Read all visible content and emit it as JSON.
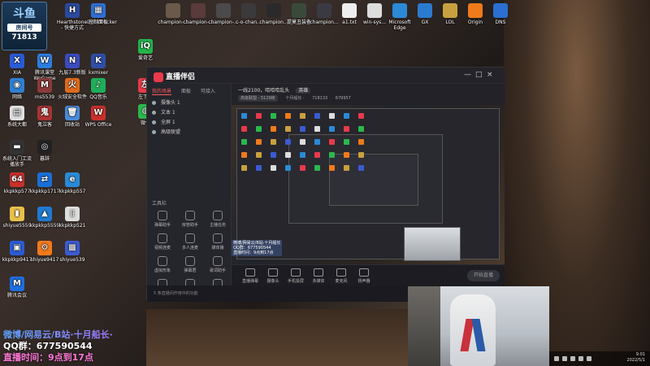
{
  "room_badge": {
    "logo": "斗鱼",
    "label": "房间号",
    "number": "71813"
  },
  "desktop_icons": [
    {
      "label": "XIA",
      "glyph": "X",
      "color": "#2a5bd7"
    },
    {
      "label": "腾讯课堂 WeGame",
      "glyph": "W",
      "color": "#2d7de0"
    },
    {
      "label": "九层7.3新版",
      "glyph": "N",
      "color": "#3b4cc0"
    },
    {
      "label": "kxmixer",
      "glyph": "K",
      "color": "#2f4ea8"
    },
    {
      "label": "网络",
      "glyph": "◉",
      "color": "#2f7fd1"
    },
    {
      "label": "ms5539",
      "glyph": "M",
      "color": "#8a3a3a"
    },
    {
      "label": "火绒安全软件",
      "glyph": "火",
      "color": "#e06a1c"
    },
    {
      "label": "QQ音乐",
      "glyph": "♪",
      "color": "#1fae5a"
    },
    {
      "label": "系统大都",
      "glyph": "▤",
      "color": "#e0e0e0"
    },
    {
      "label": "鬼泣客",
      "glyph": "鬼",
      "color": "#a33"
    },
    {
      "label": "回收站",
      "glyph": "🗑",
      "color": "#4a8ad8"
    },
    {
      "label": "WPS Office",
      "glyph": "W",
      "color": "#c9302c"
    },
    {
      "label": "系统入门工流播放手",
      "glyph": "▬",
      "color": "#333"
    },
    {
      "label": "暮辞",
      "glyph": "◎",
      "color": "#222"
    },
    {
      "label": "kkpkkp577",
      "glyph": "64",
      "color": "#c9302c"
    },
    {
      "label": "kkpkkp1717",
      "glyph": "⇄",
      "color": "#1a6fd6"
    },
    {
      "label": "kkpkkp557",
      "glyph": "e",
      "color": "#2a8ad6"
    },
    {
      "label": "shiyue5559",
      "glyph": "▮",
      "color": "#e8c04a"
    },
    {
      "label": "kkpkkp5559",
      "glyph": "▲",
      "color": "#1f7ad0"
    },
    {
      "label": "kkpkkp521",
      "glyph": "▯",
      "color": "#ddd"
    },
    {
      "label": "kkpkkp9417",
      "glyph": "▣",
      "color": "#2a5bd7"
    },
    {
      "label": "shiyue9417",
      "glyph": "⚙",
      "color": "#f07a1c"
    },
    {
      "label": "shiyue539",
      "glyph": "▩",
      "color": "#3a5bd0"
    },
    {
      "label": "腾讯会议",
      "glyph": "M",
      "color": "#1f6fe0"
    },
    {
      "label": "爱奇艺",
      "glyph": "iQ",
      "color": "#23b54a"
    },
    {
      "label": "左下盆",
      "glyph": "左",
      "color": "#e83a4b"
    },
    {
      "label": "微信",
      "glyph": "◍",
      "color": "#2ab84d"
    },
    {
      "label": "HearthstoneDeckTracker - 快捷方式",
      "glyph": "H",
      "color": "#2a4aa0"
    },
    {
      "label": "控制面板",
      "glyph": "▦",
      "color": "#2f6fd1"
    }
  ],
  "top_icons": [
    {
      "label": "champion-...",
      "color": "#6a5a4a"
    },
    {
      "label": "champion-...",
      "color": "#5a3a3a"
    },
    {
      "label": "champion-...",
      "color": "#4a4a4a"
    },
    {
      "label": "c-o-chan...",
      "color": "#3a3a3a"
    },
    {
      "label": "champion...",
      "color": "#2a2a2a"
    },
    {
      "label": "提莫丑装备",
      "color": "#3a4a3a"
    },
    {
      "label": "champion...",
      "color": "#3a3a44"
    },
    {
      "label": "a1.txt",
      "color": "#eeeeee"
    },
    {
      "label": "win-sys...",
      "color": "#dddddd"
    },
    {
      "label": "Microsoft Edge",
      "color": "#2a8ad6"
    },
    {
      "label": "GX",
      "color": "#2a7ad0"
    },
    {
      "label": "LOL",
      "color": "#c9a040"
    },
    {
      "label": "Origin",
      "color": "#f07a1c"
    },
    {
      "label": "DNS",
      "color": "#2a6fd1"
    }
  ],
  "app": {
    "brand": "直播伴侣",
    "window_controls": [
      "—",
      "□",
      "×"
    ],
    "left_tabs": [
      "我的场景",
      "面板",
      "可接入"
    ],
    "scenes": [
      "摄像头 1",
      "文本 1",
      "全屏 1",
      "高级联盟"
    ],
    "tools_title": "工具栏",
    "tools": [
      "弹幕助手",
      "房管助手",
      "主播任务",
      "视频连麦",
      "多人连麦",
      "媒体播",
      "虚拟形象",
      "弹幕君",
      "歌词助手",
      "虚拟摄像头",
      "开直播",
      "装扮"
    ],
    "stage_title": "一线2100，哈哈哈乱头",
    "stage_tag": "英雄",
    "meta": [
      "高级联盟 - 5129帐",
      "十月船长 ·",
      "718133",
      "679957"
    ],
    "foot_buttons": [
      "直播弹幕",
      "摄像头",
      "手机投屏",
      "多媒体",
      "麦克风",
      "扬声器"
    ],
    "start_label": "开始直播",
    "status": "5 条直播间作用中的功能"
  },
  "overlay": {
    "line1": "微博/网易云/B站·十月船长",
    "line2": "QQ群：677590544",
    "line3": "直播时间：9点到17点"
  },
  "stream_info": {
    "line1": "微博/网易云/B站·十月船长·",
    "line2": "QQ群：677590544",
    "line3": "直播时间：9点到17点"
  },
  "tray": {
    "time": "9:01",
    "date": "2022/5/1"
  }
}
